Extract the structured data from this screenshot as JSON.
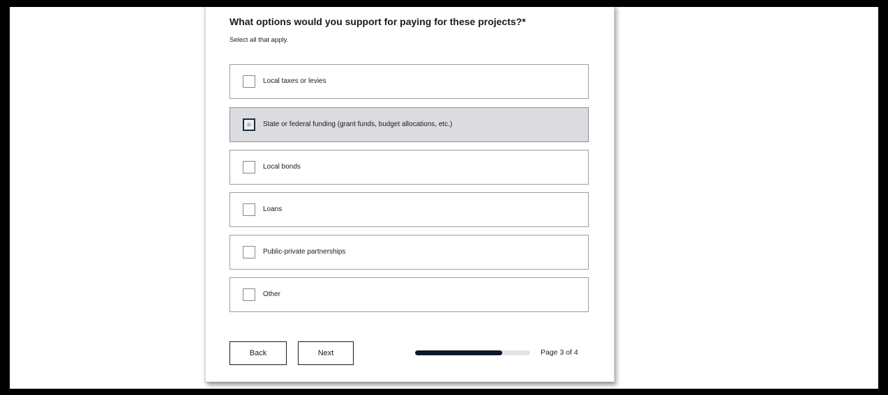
{
  "question": {
    "title": "What options would you support for paying for these projects?*",
    "subtitle": "Select all that apply."
  },
  "options": [
    {
      "label": "Local taxes or levies",
      "checked": false,
      "highlighted": false
    },
    {
      "label": "State or federal funding (grant funds, budget allocations, etc.)",
      "checked": false,
      "highlighted": true
    },
    {
      "label": "Local bonds",
      "checked": false,
      "highlighted": false
    },
    {
      "label": "Loans",
      "checked": false,
      "highlighted": false
    },
    {
      "label": "Public-private partnerships",
      "checked": false,
      "highlighted": false
    },
    {
      "label": "Other",
      "checked": false,
      "highlighted": false
    }
  ],
  "navigation": {
    "back_label": "Back",
    "next_label": "Next"
  },
  "progress": {
    "current_page": 3,
    "total_pages": 4,
    "fraction": 0.76,
    "label": "Page 3 of 4"
  },
  "colors": {
    "progress_fill": "#0d1829",
    "progress_track": "#e3e3e6",
    "highlight_bg": "#dcdce0"
  }
}
